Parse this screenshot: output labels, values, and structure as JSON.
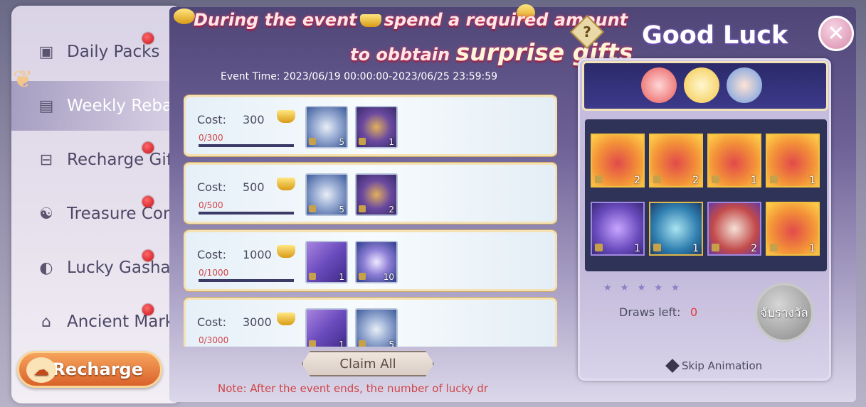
{
  "sidebar": {
    "items": [
      {
        "label": "Daily Packs",
        "icon": "gift-box-icon",
        "dot": true,
        "active": false
      },
      {
        "label": "Weekly Reba",
        "icon": "calendar-icon",
        "dot": false,
        "active": true
      },
      {
        "label": "Recharge Gif",
        "icon": "chest-icon",
        "dot": true,
        "active": false
      },
      {
        "label": "Treasure Cor",
        "icon": "yin-yang-icon",
        "dot": true,
        "active": false
      },
      {
        "label": "Lucky Gasha",
        "icon": "gacha-ball-icon",
        "dot": true,
        "active": false
      },
      {
        "label": "Ancient Mark",
        "icon": "market-icon",
        "dot": true,
        "active": false
      }
    ],
    "recharge_label": "Recharge"
  },
  "banner": {
    "line1": "During the event",
    "line1b": "spend a required amount",
    "line2": "to obbtain",
    "line2_big": "surprise gifts",
    "help": "?"
  },
  "event_time": "Event Time: 2023/06/19 00:00:00-2023/06/25 23:59:59",
  "rows": [
    {
      "cost_label": "Cost:",
      "cost": "300",
      "progress": "0/300",
      "items": [
        {
          "kind": "silver",
          "icon": "silver-coin-icon",
          "count": "5"
        },
        {
          "kind": "chest",
          "icon": "treasure-chest-icon",
          "count": "1"
        }
      ]
    },
    {
      "cost_label": "Cost:",
      "cost": "500",
      "progress": "0/500",
      "items": [
        {
          "kind": "silver",
          "icon": "silver-coin-icon",
          "count": "5"
        },
        {
          "kind": "chest",
          "icon": "treasure-chest-icon",
          "count": "2"
        }
      ]
    },
    {
      "cost_label": "Cost:",
      "cost": "1000",
      "progress": "0/1000",
      "items": [
        {
          "kind": "ticket",
          "icon": "ticket-icon",
          "count": "1"
        },
        {
          "kind": "orb",
          "icon": "spirit-orb-icon",
          "count": "10"
        }
      ]
    },
    {
      "cost_label": "Cost:",
      "cost": "3000",
      "progress": "0/3000",
      "items": [
        {
          "kind": "ticket",
          "icon": "ticket-icon",
          "count": "1"
        },
        {
          "kind": "silver",
          "icon": "silver-coin-icon",
          "count": "5"
        }
      ]
    }
  ],
  "claim_all": "Claim All",
  "note": "Note: After the event ends, the number of lucky dr",
  "gacha": {
    "title": "Good Luck",
    "close": "✕",
    "grid": [
      {
        "kind": "meat",
        "icon": "meat-icon",
        "count": "2"
      },
      {
        "kind": "meat",
        "icon": "meat-icon",
        "count": "2"
      },
      {
        "kind": "meat",
        "icon": "meat-icon",
        "count": "1"
      },
      {
        "kind": "meat",
        "icon": "meat-icon",
        "count": "1"
      },
      {
        "kind": "purple",
        "icon": "purple-chest-icon",
        "count": "1"
      },
      {
        "kind": "blue",
        "icon": "blue-chest-icon",
        "count": "1"
      },
      {
        "kind": "scroll",
        "icon": "scroll-icon",
        "count": "2"
      },
      {
        "kind": "meat",
        "icon": "meat-icon",
        "count": "1"
      }
    ],
    "stars": "★ ★ ★ ★ ★",
    "draws_label": "Draws left:",
    "draws_value": "0",
    "draw_button": "จับรางวัล",
    "skip_label": "Skip Animation"
  }
}
